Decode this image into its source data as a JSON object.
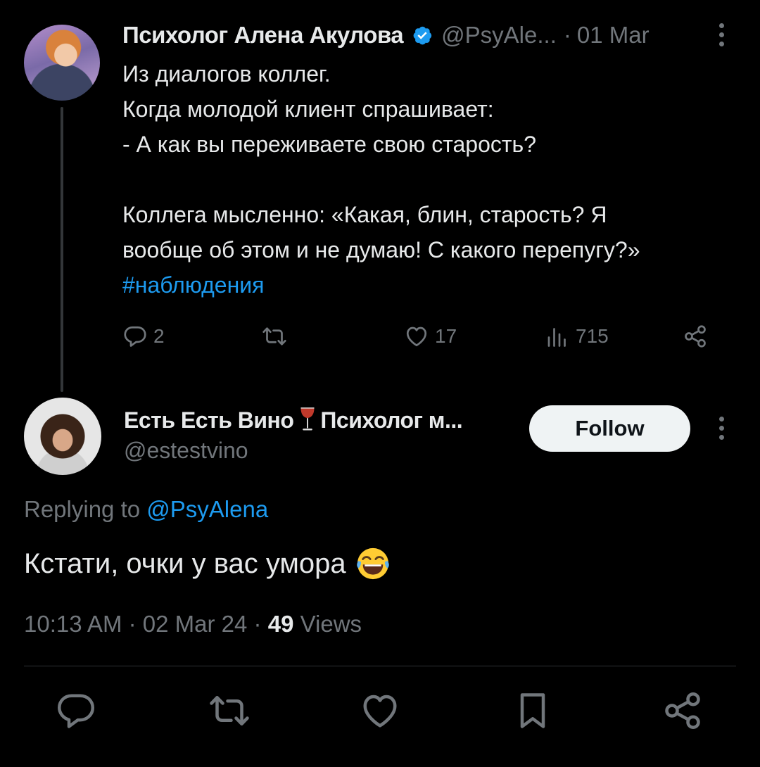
{
  "parent_tweet": {
    "author_name": "Психолог Алена Акулова",
    "handle": "@PsyAle...",
    "date": "01 Mar",
    "separator": "·",
    "text_lines": [
      "Из диалогов коллег.",
      "Когда молодой клиент спрашивает:",
      "- А как вы переживаете свою старость?",
      "",
      "Коллега мысленно: «Какая, блин, старость? Я",
      "вообще об этом и не думаю! С какого перепугу?»"
    ],
    "hashtag": "#наблюдения",
    "replies_count": "2",
    "likes_count": "17",
    "views_count": "715"
  },
  "reply_tweet": {
    "author_name": "Есть Есть Вино",
    "author_name_suffix": "Психолог м...",
    "handle": "@estestvino",
    "follow_label": "Follow",
    "replying_prefix": "Replying to",
    "replying_to": "@PsyAlena",
    "text": "Кстати, очки у вас умора",
    "time": "10:13 AM",
    "date": "02 Mar 24",
    "separator": "·",
    "views_number": "49",
    "views_label": "Views"
  },
  "colors": {
    "background": "#000000",
    "text_primary": "#e7e9ea",
    "text_secondary": "#71767b",
    "accent": "#1d9bf0",
    "divider": "#2f3336"
  },
  "icons": {
    "verified": "verified-badge-icon",
    "reply": "reply-icon",
    "retweet": "retweet-icon",
    "like": "heart-icon",
    "views": "views-chart-icon",
    "share": "share-icon",
    "bookmark": "bookmark-icon",
    "more": "more-vertical-icon",
    "wine": "wine-glass-icon",
    "emoji": "laughing-tears-emoji-icon"
  }
}
